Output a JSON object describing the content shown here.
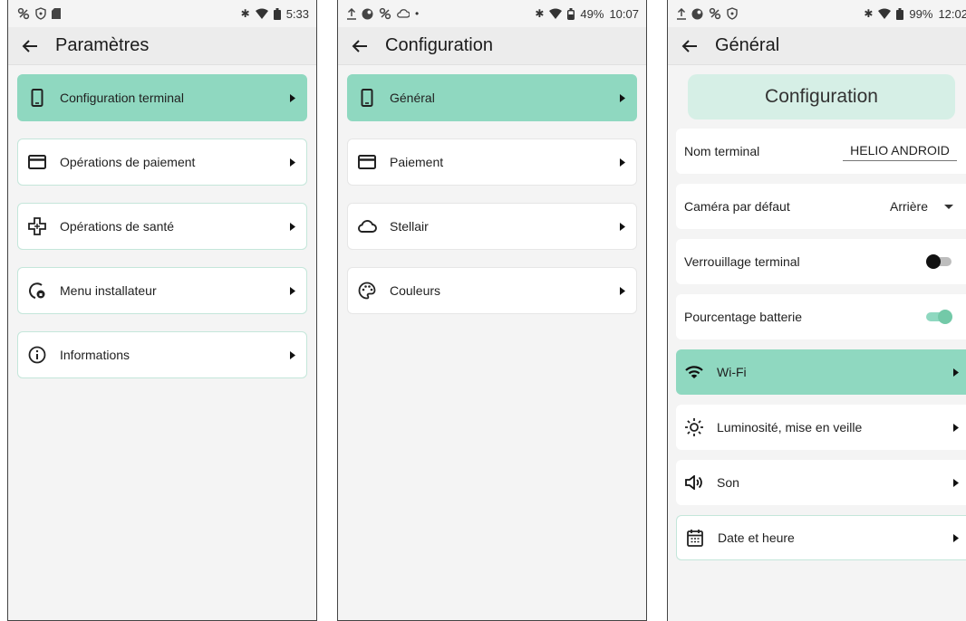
{
  "colors": {
    "accent": "#8fd8c0",
    "accent_light": "#d6efe6",
    "border": "#c4e6da",
    "background": "#f4f4f4"
  },
  "screen1": {
    "status": {
      "time": "5:33"
    },
    "title": "Paramètres",
    "items": [
      {
        "label": "Configuration terminal",
        "icon": "phone-icon",
        "active": true
      },
      {
        "label": "Opérations de paiement",
        "icon": "credit-card-icon",
        "active": false
      },
      {
        "label": "Opérations de santé",
        "icon": "health-cross-icon",
        "active": false
      },
      {
        "label": "Menu installateur",
        "icon": "installer-icon",
        "active": false
      },
      {
        "label": "Informations",
        "icon": "info-icon",
        "active": false
      }
    ]
  },
  "screen2": {
    "status": {
      "battery": "49%",
      "time": "10:07"
    },
    "title": "Configuration",
    "items": [
      {
        "label": "Général",
        "icon": "phone-icon",
        "active": true
      },
      {
        "label": "Paiement",
        "icon": "credit-card-icon",
        "active": false
      },
      {
        "label": "Stellair",
        "icon": "cloud-icon",
        "active": false
      },
      {
        "label": "Couleurs",
        "icon": "palette-icon",
        "active": false
      }
    ]
  },
  "screen3": {
    "status": {
      "battery": "99%",
      "time": "12:02"
    },
    "title": "Général",
    "header": "Configuration",
    "terminal_name": {
      "label": "Nom terminal",
      "value": "HELIO ANDROID"
    },
    "camera": {
      "label": "Caméra par défaut",
      "value": "Arrière"
    },
    "lock": {
      "label": "Verrouillage terminal",
      "on": false
    },
    "battery_pct": {
      "label": "Pourcentage batterie",
      "on": true
    },
    "nav": [
      {
        "label": "Wi-Fi",
        "icon": "wifi-icon",
        "active": true
      },
      {
        "label": "Luminosité, mise en veille",
        "icon": "brightness-icon",
        "active": false
      },
      {
        "label": "Son",
        "icon": "volume-icon",
        "active": false
      },
      {
        "label": "Date et heure",
        "icon": "calendar-icon",
        "active": false
      }
    ]
  }
}
